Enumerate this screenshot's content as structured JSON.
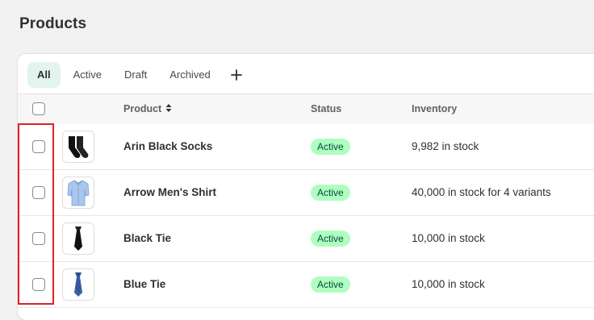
{
  "page": {
    "title": "Products"
  },
  "tabs": [
    {
      "label": "All",
      "selected": true
    },
    {
      "label": "Active",
      "selected": false
    },
    {
      "label": "Draft",
      "selected": false
    },
    {
      "label": "Archived",
      "selected": false
    }
  ],
  "tab_add_icon": "plus-icon",
  "table": {
    "columns": {
      "product": "Product",
      "status": "Status",
      "inventory": "Inventory"
    },
    "sort_icon": "sort-icon",
    "rows": [
      {
        "name": "Arin Black Socks",
        "status": "Active",
        "inventory": "9,982 in stock",
        "thumb_icon": "socks-icon"
      },
      {
        "name": "Arrow Men's Shirt",
        "status": "Active",
        "inventory": "40,000 in stock for 4 variants",
        "thumb_icon": "shirt-icon"
      },
      {
        "name": "Black Tie",
        "status": "Active",
        "inventory": "10,000 in stock",
        "thumb_icon": "black-tie-icon"
      },
      {
        "name": "Blue Tie",
        "status": "Active",
        "inventory": "10,000 in stock",
        "thumb_icon": "blue-tie-icon"
      }
    ]
  },
  "colors": {
    "selected_tab_bg": "#e3f3ee",
    "active_badge_bg": "#affebf",
    "active_badge_text": "#014b40",
    "highlight_border": "#e0202a"
  }
}
